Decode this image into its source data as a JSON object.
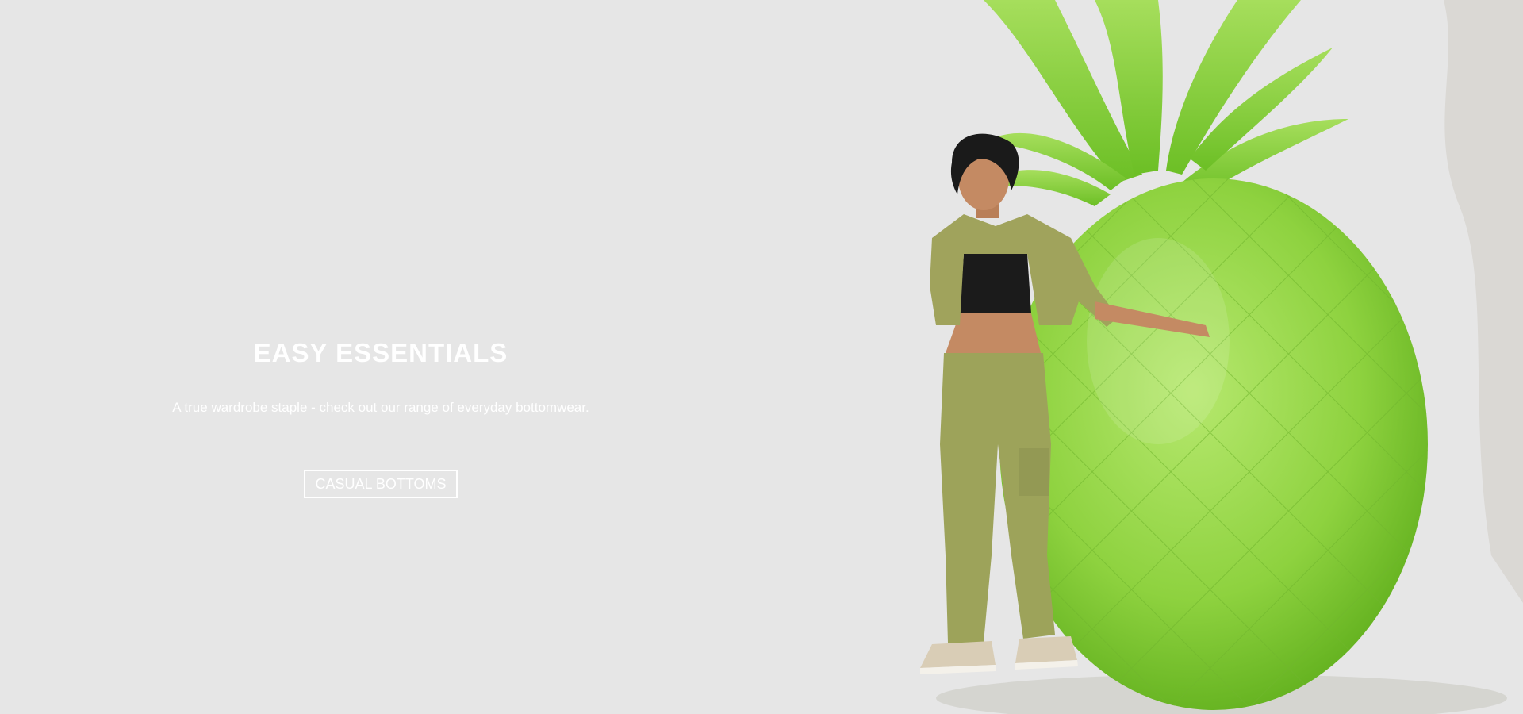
{
  "hero": {
    "title": "EASY ESSENTIALS",
    "subtitle": "A true wardrobe staple - check out our range of everyday bottomwear.",
    "cta_label": "CASUAL BOTTOMS"
  },
  "colors": {
    "background": "#e6e6e6",
    "text": "#ffffff",
    "outfit": "#9da35a",
    "pineapple": "#8ed23f"
  }
}
